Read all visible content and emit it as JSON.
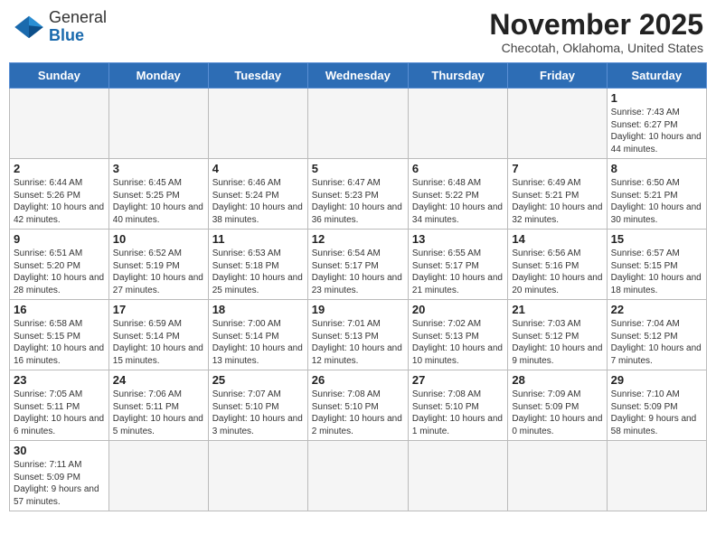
{
  "header": {
    "logo_general": "General",
    "logo_blue": "Blue",
    "month_title": "November 2025",
    "subtitle": "Checotah, Oklahoma, United States"
  },
  "weekdays": [
    "Sunday",
    "Monday",
    "Tuesday",
    "Wednesday",
    "Thursday",
    "Friday",
    "Saturday"
  ],
  "weeks": [
    [
      {
        "day": "",
        "info": ""
      },
      {
        "day": "",
        "info": ""
      },
      {
        "day": "",
        "info": ""
      },
      {
        "day": "",
        "info": ""
      },
      {
        "day": "",
        "info": ""
      },
      {
        "day": "",
        "info": ""
      },
      {
        "day": "1",
        "info": "Sunrise: 7:43 AM\nSunset: 6:27 PM\nDaylight: 10 hours and 44 minutes."
      }
    ],
    [
      {
        "day": "2",
        "info": "Sunrise: 6:44 AM\nSunset: 5:26 PM\nDaylight: 10 hours and 42 minutes."
      },
      {
        "day": "3",
        "info": "Sunrise: 6:45 AM\nSunset: 5:25 PM\nDaylight: 10 hours and 40 minutes."
      },
      {
        "day": "4",
        "info": "Sunrise: 6:46 AM\nSunset: 5:24 PM\nDaylight: 10 hours and 38 minutes."
      },
      {
        "day": "5",
        "info": "Sunrise: 6:47 AM\nSunset: 5:23 PM\nDaylight: 10 hours and 36 minutes."
      },
      {
        "day": "6",
        "info": "Sunrise: 6:48 AM\nSunset: 5:22 PM\nDaylight: 10 hours and 34 minutes."
      },
      {
        "day": "7",
        "info": "Sunrise: 6:49 AM\nSunset: 5:21 PM\nDaylight: 10 hours and 32 minutes."
      },
      {
        "day": "8",
        "info": "Sunrise: 6:50 AM\nSunset: 5:21 PM\nDaylight: 10 hours and 30 minutes."
      }
    ],
    [
      {
        "day": "9",
        "info": "Sunrise: 6:51 AM\nSunset: 5:20 PM\nDaylight: 10 hours and 28 minutes."
      },
      {
        "day": "10",
        "info": "Sunrise: 6:52 AM\nSunset: 5:19 PM\nDaylight: 10 hours and 27 minutes."
      },
      {
        "day": "11",
        "info": "Sunrise: 6:53 AM\nSunset: 5:18 PM\nDaylight: 10 hours and 25 minutes."
      },
      {
        "day": "12",
        "info": "Sunrise: 6:54 AM\nSunset: 5:17 PM\nDaylight: 10 hours and 23 minutes."
      },
      {
        "day": "13",
        "info": "Sunrise: 6:55 AM\nSunset: 5:17 PM\nDaylight: 10 hours and 21 minutes."
      },
      {
        "day": "14",
        "info": "Sunrise: 6:56 AM\nSunset: 5:16 PM\nDaylight: 10 hours and 20 minutes."
      },
      {
        "day": "15",
        "info": "Sunrise: 6:57 AM\nSunset: 5:15 PM\nDaylight: 10 hours and 18 minutes."
      }
    ],
    [
      {
        "day": "16",
        "info": "Sunrise: 6:58 AM\nSunset: 5:15 PM\nDaylight: 10 hours and 16 minutes."
      },
      {
        "day": "17",
        "info": "Sunrise: 6:59 AM\nSunset: 5:14 PM\nDaylight: 10 hours and 15 minutes."
      },
      {
        "day": "18",
        "info": "Sunrise: 7:00 AM\nSunset: 5:14 PM\nDaylight: 10 hours and 13 minutes."
      },
      {
        "day": "19",
        "info": "Sunrise: 7:01 AM\nSunset: 5:13 PM\nDaylight: 10 hours and 12 minutes."
      },
      {
        "day": "20",
        "info": "Sunrise: 7:02 AM\nSunset: 5:13 PM\nDaylight: 10 hours and 10 minutes."
      },
      {
        "day": "21",
        "info": "Sunrise: 7:03 AM\nSunset: 5:12 PM\nDaylight: 10 hours and 9 minutes."
      },
      {
        "day": "22",
        "info": "Sunrise: 7:04 AM\nSunset: 5:12 PM\nDaylight: 10 hours and 7 minutes."
      }
    ],
    [
      {
        "day": "23",
        "info": "Sunrise: 7:05 AM\nSunset: 5:11 PM\nDaylight: 10 hours and 6 minutes."
      },
      {
        "day": "24",
        "info": "Sunrise: 7:06 AM\nSunset: 5:11 PM\nDaylight: 10 hours and 5 minutes."
      },
      {
        "day": "25",
        "info": "Sunrise: 7:07 AM\nSunset: 5:10 PM\nDaylight: 10 hours and 3 minutes."
      },
      {
        "day": "26",
        "info": "Sunrise: 7:08 AM\nSunset: 5:10 PM\nDaylight: 10 hours and 2 minutes."
      },
      {
        "day": "27",
        "info": "Sunrise: 7:08 AM\nSunset: 5:10 PM\nDaylight: 10 hours and 1 minute."
      },
      {
        "day": "28",
        "info": "Sunrise: 7:09 AM\nSunset: 5:09 PM\nDaylight: 10 hours and 0 minutes."
      },
      {
        "day": "29",
        "info": "Sunrise: 7:10 AM\nSunset: 5:09 PM\nDaylight: 9 hours and 58 minutes."
      }
    ],
    [
      {
        "day": "30",
        "info": "Sunrise: 7:11 AM\nSunset: 5:09 PM\nDaylight: 9 hours and 57 minutes."
      },
      {
        "day": "",
        "info": ""
      },
      {
        "day": "",
        "info": ""
      },
      {
        "day": "",
        "info": ""
      },
      {
        "day": "",
        "info": ""
      },
      {
        "day": "",
        "info": ""
      },
      {
        "day": "",
        "info": ""
      }
    ]
  ]
}
